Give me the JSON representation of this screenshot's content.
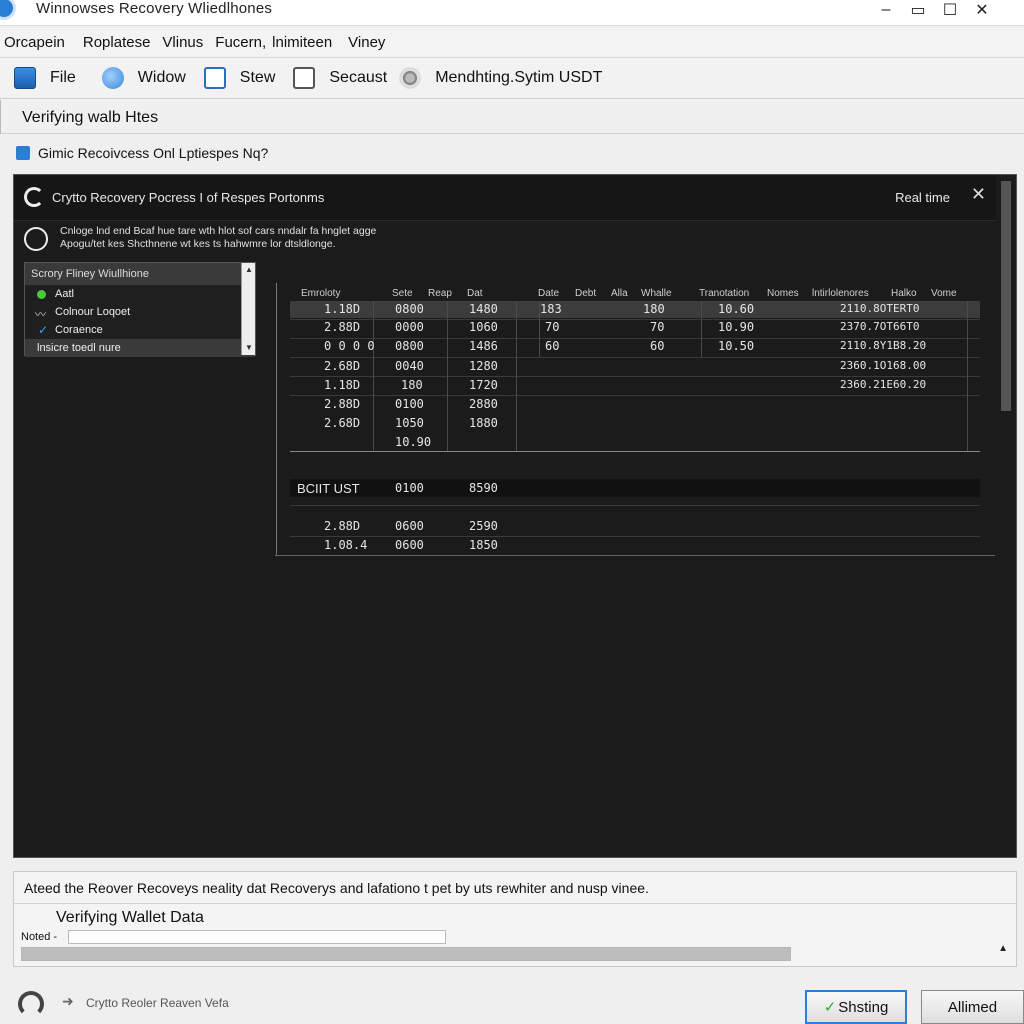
{
  "window": {
    "title": "Winnowses Recovery Wliedlhones",
    "controls": {
      "minimize": "–",
      "restore": "▭",
      "maximize": "☐",
      "close": "✕"
    }
  },
  "menu": [
    "Orcapein",
    "Roplatese",
    "Vlinus",
    "Fucern,",
    "lnimiteen",
    "Viney"
  ],
  "toolbar": [
    {
      "label": "File",
      "icon": "file-icon"
    },
    {
      "label": "Widow",
      "icon": "window-icon"
    },
    {
      "label": "Stew",
      "icon": "stew-icon"
    },
    {
      "label": "Secaust",
      "icon": "document-icon"
    },
    {
      "label": "Mendhting.Sytim USDT",
      "icon": "gear-icon"
    }
  ],
  "subheader": "Verifying walb Htes",
  "info_line": "Gimic Recoivcess Onl Lptiespes Nq?",
  "panel": {
    "title": "Crytto Recovery Pocress I of Respes Portonms",
    "right_label": "Real time",
    "close": "✕",
    "desc_line1": "Cnloge lnd end Bcaf hue tare wth hlot sof cars nndalr fa hnglet agge",
    "desc_line2": "Apogu/tet kes Shcthnene wt kes ts hahwmre lor dtsldlonge.",
    "list": {
      "header": "Scrory Fliney Wiullhione",
      "items": [
        "Aatl",
        "Colnour Loqoet",
        "Coraence"
      ],
      "footer": "lnsicre toedl nure"
    }
  },
  "table": {
    "headers": [
      "Emroloty",
      "Sete",
      "Reap",
      "Dat",
      "Date",
      "Debt",
      "Alla",
      "Whalle",
      "Tranotation",
      "Nomes",
      "lntirlolenores",
      "Halko",
      "Vome"
    ],
    "rows": [
      [
        "1.18D",
        "0800",
        "1480",
        "183",
        "180",
        "10.60",
        "2110.8OTERT0"
      ],
      [
        "2.88D",
        "0000",
        "1060",
        "70",
        "70",
        "10.90",
        "2370.7OT66T0"
      ],
      [
        "0 0 0 0",
        "0800",
        "1486",
        "60",
        "60",
        "10.50",
        "2110.8Y1B8.20"
      ],
      [
        "2.68D",
        "0040",
        "1280",
        "",
        "",
        "",
        "2360.1O168.00"
      ],
      [
        "1.18D",
        "180",
        "1720",
        "",
        "",
        "",
        "2360.21E60.20"
      ],
      [
        "2.88D",
        "0100",
        "2880",
        "",
        "",
        "",
        ""
      ],
      [
        "2.68D",
        "1050",
        "1880",
        "",
        "",
        "",
        ""
      ],
      [
        "",
        "10.90",
        "",
        "",
        "",
        "",
        ""
      ]
    ],
    "group_label": "BCIIT UST",
    "group_row": [
      "0100",
      "8590"
    ],
    "lower_rows": [
      [
        "2.88D",
        "0600",
        "2590"
      ],
      [
        "1.08.4",
        "0600",
        "1850"
      ]
    ]
  },
  "bottom": {
    "notice": "Ateed the Reover Recoveys neality dat Recoverys and lafationo t pet by uts rewhiter and nusp vinee.",
    "status_title": "Verifying Wallet Data",
    "noted_label": "Noted -",
    "noted_value": "",
    "progress_percent": 100
  },
  "statusbar": {
    "text": "Crytto Reoler Reaven Vefa",
    "primary_button": "Shsting",
    "secondary_button": "Allimed"
  },
  "colors": {
    "accent": "#2a7fd4",
    "panel_bg": "#1b1b1b",
    "ok_green": "#46c83f"
  }
}
